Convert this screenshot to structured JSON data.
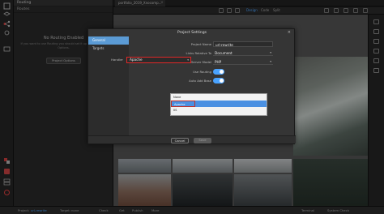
{
  "panel": {
    "tab": "Routing",
    "subtab": "Routes",
    "title": "No Routing Enabled",
    "text": "If you want to use Routing you should set it up in the Project Options.",
    "button": "Project Options"
  },
  "document": {
    "tab": "portfolio_2019_Xnocomp..."
  },
  "views": [
    "Design",
    "Code",
    "Split"
  ],
  "dialog": {
    "title": "Project Settings",
    "nav": [
      "General",
      "Targets"
    ],
    "fields": [
      {
        "label": "Project Name",
        "value": "url-rewrite"
      },
      {
        "label": "Links Relative To",
        "value": "Document"
      },
      {
        "label": "Server Model",
        "value": "PHP"
      },
      {
        "label": "Use Routing",
        "value": ""
      },
      {
        "label": "Auto Add Base",
        "value": ""
      }
    ],
    "handler_label": "Handler",
    "handler_value": "Apache",
    "handler_options": [
      "None",
      "Apache",
      "IIS"
    ],
    "cancel": "Cancel",
    "save": "Save"
  },
  "status": {
    "project_label": "Project:",
    "project_value": "url-rewrite",
    "target_label": "Target:",
    "target_value": "none",
    "items": [
      "Check",
      "Get",
      "Publish",
      "More"
    ],
    "right_items": [
      "Terminal",
      "System Check"
    ]
  },
  "colors": {
    "accent": "#4aa3ff",
    "selected": "#4a90e2",
    "highlight": "#e02828"
  }
}
